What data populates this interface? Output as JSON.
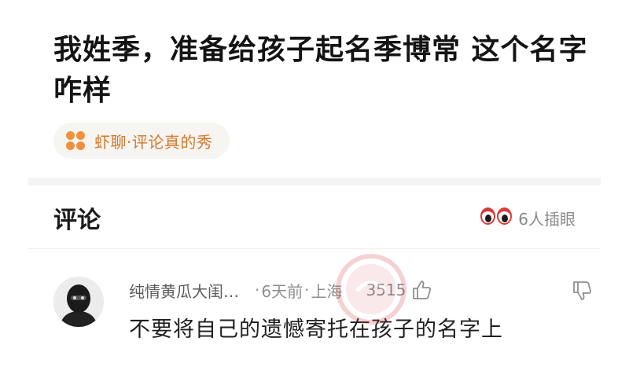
{
  "post": {
    "title": "我姓季，准备给孩子起名季博常 这个名字咋样"
  },
  "topic": {
    "icon": "flower-icon",
    "label": "虾聊·评论真的秀"
  },
  "comments_section": {
    "title": "评论",
    "onlookers_icon": "eyes-icon",
    "onlookers_label": "6人插眼"
  },
  "comment": {
    "username": "纯情黄瓜大闺…",
    "time": "6天前",
    "location": "上海",
    "separator": "·",
    "likes": "3515",
    "text": "不要将自己的遗憾寄托在孩子的名字上"
  },
  "colors": {
    "accent_orange": "#d4772b",
    "eye_red": "#d93a3a",
    "watermark_red": "#d0383f"
  }
}
